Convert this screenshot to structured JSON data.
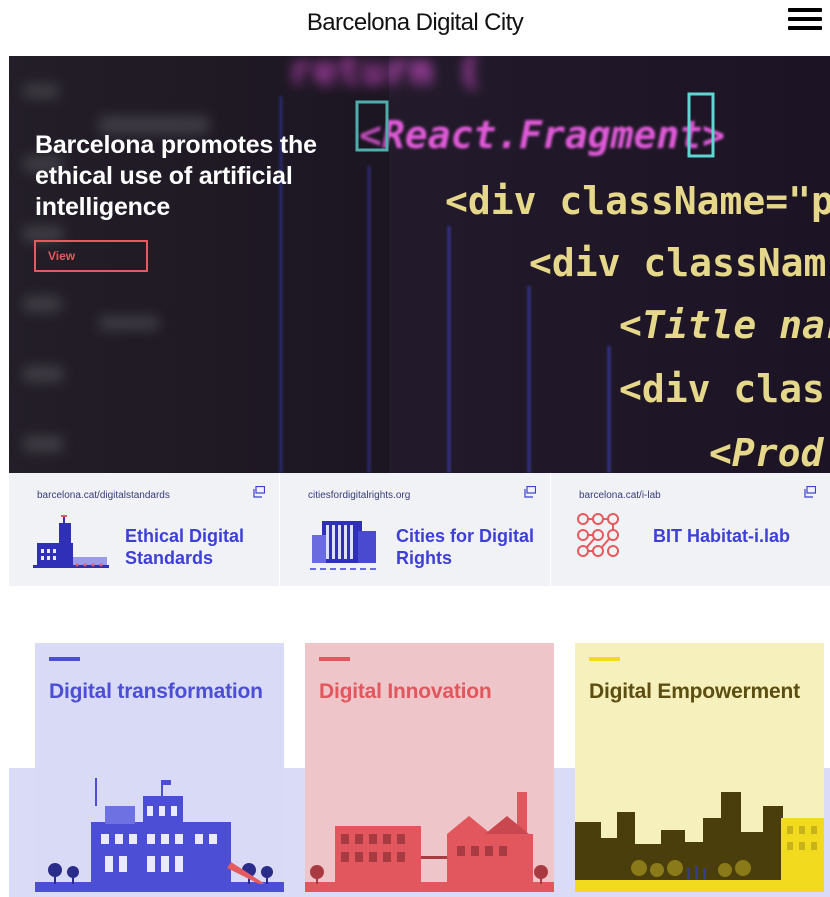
{
  "header": {
    "site_title": "Barcelona Digital City",
    "menu_icon": "hamburger-menu-icon"
  },
  "hero": {
    "title": "Barcelona promotes the ethical use of artificial intelligence",
    "view_label": "View",
    "code_lines": [
      "return (",
      "<React.Fragment>",
      "<div className=\"py",
      "<div classNam",
      "<Title nar",
      "<div clas",
      "<Prod"
    ],
    "colors": {
      "accent": "#e55a5f",
      "code_yellow": "#e6d88a",
      "code_pink": "#e05ad8",
      "code_cyan": "#5ed6d1"
    }
  },
  "links": [
    {
      "url": "barcelona.cat/digitalstandards",
      "label": "Ethical Digital Standards",
      "icon": "external-link-icon"
    },
    {
      "url": "citiesfordigitalrights.org",
      "label": "Cities for Digital Rights",
      "icon": "external-link-icon"
    },
    {
      "url": "barcelona.cat/i-lab",
      "label": "BIT Habitat-i.lab",
      "icon": "external-link-icon"
    }
  ],
  "cards": [
    {
      "title": "Digital transformation",
      "color": "#4c4fd6",
      "bg": "#d9dbf6"
    },
    {
      "title": "Digital Innovation",
      "color": "#e2565d",
      "bg": "#eec5c8"
    },
    {
      "title": "Digital Empowerment",
      "color": "#5c4e10",
      "bg": "#f6f0bd"
    }
  ]
}
